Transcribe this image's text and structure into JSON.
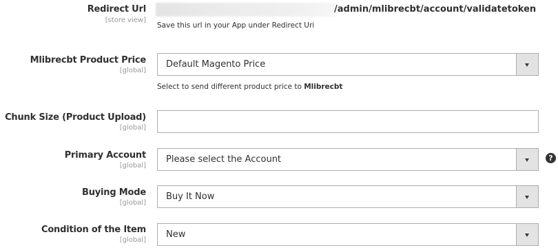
{
  "redirect_url": {
    "label": "Redirect Url",
    "scope": "[store view]",
    "value": "/admin/mlibrecbt/account/validatetoken",
    "note": "Save this url in your App under Redirect Uri"
  },
  "product_price": {
    "label": "Mlibrecbt Product Price",
    "scope": "[global]",
    "selected": "Default Magento Price",
    "note_prefix": "Select to send different product price to ",
    "note_bold": "Mlibrecbt"
  },
  "chunk_size": {
    "label": "Chunk Size (Product Upload)",
    "scope": "[global]",
    "value": ""
  },
  "primary_account": {
    "label": "Primary Account",
    "scope": "[global]",
    "selected": "Please select the Account",
    "help_icon": "question-circle-icon"
  },
  "buying_mode": {
    "label": "Buying Mode",
    "scope": "[global]",
    "selected": "Buy It Now"
  },
  "condition": {
    "label": "Condition of the Item",
    "scope": "[global]",
    "selected": "New"
  }
}
